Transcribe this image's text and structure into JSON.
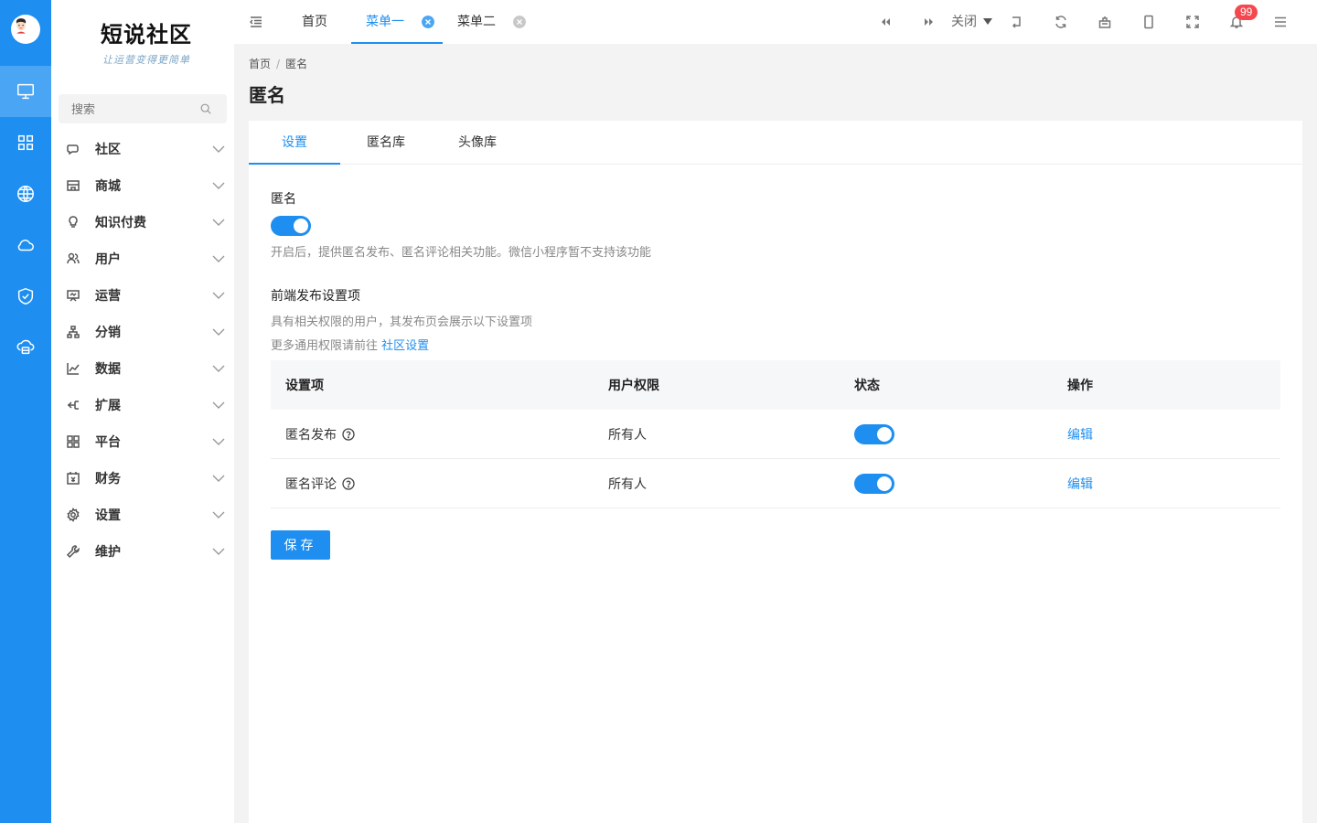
{
  "sidebar": {
    "logo_title": "短说社区",
    "logo_subtitle": "让运营变得更简单",
    "search_placeholder": "搜索",
    "items": [
      {
        "label": "社区",
        "icon": "chat-icon"
      },
      {
        "label": "商城",
        "icon": "store-icon"
      },
      {
        "label": "知识付费",
        "icon": "lightbulb-icon"
      },
      {
        "label": "用户",
        "icon": "users-icon"
      },
      {
        "label": "运营",
        "icon": "presentation-icon"
      },
      {
        "label": "分销",
        "icon": "network-icon"
      },
      {
        "label": "数据",
        "icon": "line-chart-icon"
      },
      {
        "label": "扩展",
        "icon": "extend-icon"
      },
      {
        "label": "平台",
        "icon": "grid-icon"
      },
      {
        "label": "财务",
        "icon": "calendar-icon"
      },
      {
        "label": "设置",
        "icon": "gear-icon"
      },
      {
        "label": "维护",
        "icon": "wrench-icon"
      }
    ]
  },
  "topbar": {
    "tabs": [
      {
        "label": "首页"
      },
      {
        "label": "菜单一"
      },
      {
        "label": "菜单二"
      }
    ],
    "close_label": "关闭",
    "notification_count": "99"
  },
  "breadcrumb": {
    "home": "首页",
    "current": "匿名"
  },
  "page_title": "匿名",
  "content_tabs": [
    {
      "label": "设置"
    },
    {
      "label": "匿名库"
    },
    {
      "label": "头像库"
    }
  ],
  "settings": {
    "anon_label": "匿名",
    "anon_help": "开启后，提供匿名发布、匿名评论相关功能。微信小程序暂不支持该功能",
    "frontend_label": "前端发布设置项",
    "frontend_help1": "具有相关权限的用户，其发布页会展示以下设置项",
    "frontend_help2_prefix": "更多通用权限请前往 ",
    "frontend_help2_link": "社区设置"
  },
  "table": {
    "headers": [
      "设置项",
      "用户权限",
      "状态",
      "操作"
    ],
    "rows": [
      {
        "item": "匿名发布",
        "permission": "所有人",
        "action": "编辑"
      },
      {
        "item": "匿名评论",
        "permission": "所有人",
        "action": "编辑"
      }
    ]
  },
  "save_label": "保存",
  "colors": {
    "accent": "#1e8ff0",
    "rail": "#1e8ff0",
    "badge": "#f5484e"
  }
}
